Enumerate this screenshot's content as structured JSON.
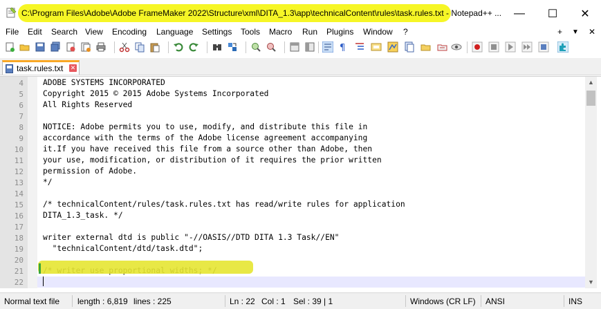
{
  "window": {
    "title": "C:\\Program Files\\Adobe\\Adobe FrameMaker 2022\\Structure\\xml\\DITA_1.3\\app\\technicalContent\\rules\\task.rules.txt - Notepad++ ...",
    "minimize": "—",
    "maximize": "☐",
    "close": "✕"
  },
  "menu": {
    "items": [
      "File",
      "Edit",
      "Search",
      "View",
      "Encoding",
      "Language",
      "Settings",
      "Tools",
      "Macro",
      "Run",
      "Plugins",
      "Window",
      "?"
    ],
    "right": [
      "+",
      "▼",
      "✕"
    ]
  },
  "tab": {
    "label": "task.rules.txt",
    "close": "✕"
  },
  "editor": {
    "lines": [
      {
        "n": "4",
        "text": "ADOBE SYSTEMS INCORPORATED"
      },
      {
        "n": "5",
        "text": "Copyright 2015 © 2015 Adobe Systems Incorporated"
      },
      {
        "n": "6",
        "text": "All Rights Reserved"
      },
      {
        "n": "7",
        "text": ""
      },
      {
        "n": "8",
        "text": "NOTICE: Adobe permits you to use, modify, and distribute this file in"
      },
      {
        "n": "9",
        "text": "accordance with the terms of the Adobe license agreement accompanying"
      },
      {
        "n": "10",
        "text": "it.If you have received this file from a source other than Adobe, then"
      },
      {
        "n": "11",
        "text": "your use, modification, or distribution of it requires the prior written"
      },
      {
        "n": "12",
        "text": "permission of Adobe."
      },
      {
        "n": "13",
        "text": "*/"
      },
      {
        "n": "14",
        "text": ""
      },
      {
        "n": "15",
        "text": "/* technicalContent/rules/task.rules.txt has read/write rules for application"
      },
      {
        "n": "16",
        "text": "DITA_1.3_task. */"
      },
      {
        "n": "17",
        "text": ""
      },
      {
        "n": "18",
        "text": "writer external dtd is public \"-//OASIS//DTD DITA 1.3 Task//EN\""
      },
      {
        "n": "19",
        "text": "  \"technicalContent/dtd/task.dtd\";"
      },
      {
        "n": "20",
        "text": ""
      },
      {
        "n": "21",
        "text": "/* writer use proportional widths; */"
      },
      {
        "n": "22",
        "text": ""
      }
    ]
  },
  "status": {
    "type": "Normal text file",
    "length": "length : 6,819",
    "lines": "lines : 225",
    "ln": "Ln : 22",
    "col": "Col : 1",
    "sel": "Sel : 39 | 1",
    "eol": "Windows (CR LF)",
    "encoding": "ANSI",
    "mode": "INS"
  },
  "colors": {
    "highlight": "#f4f400",
    "tab_accent": "#f9a825",
    "current_line": "#e8e8ff"
  }
}
